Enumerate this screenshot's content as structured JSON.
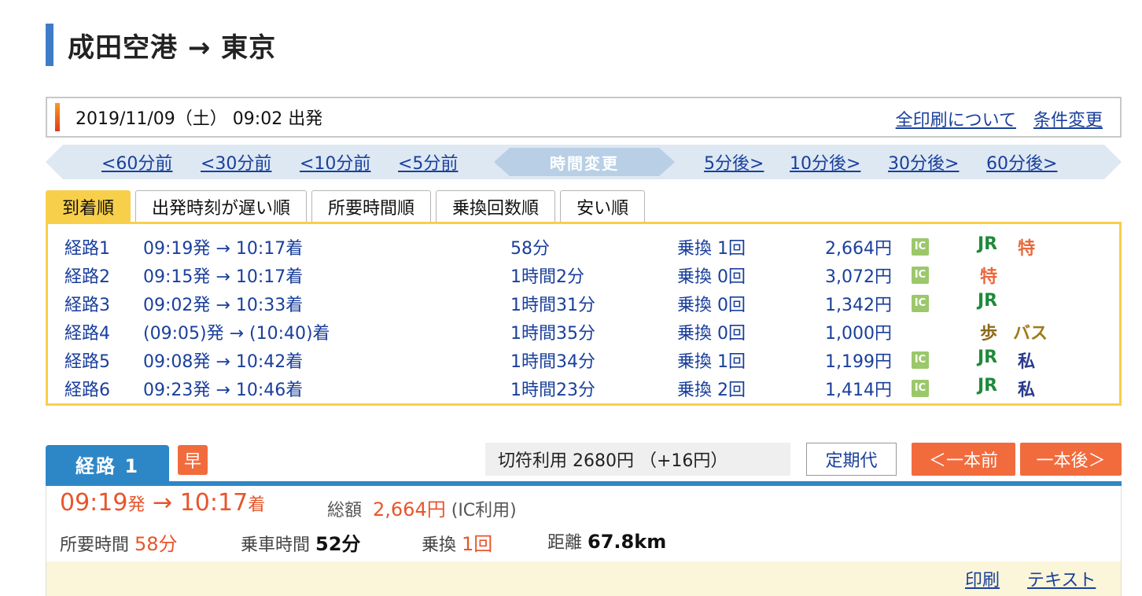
{
  "title": "成田空港 → 東京",
  "search": {
    "datetime": "2019/11/09（土） 09:02 出発",
    "print_all": "全印刷について",
    "change_cond": "条件変更"
  },
  "time_shift": {
    "before": [
      "<60分前",
      "<30分前",
      "<10分前",
      "<5分前"
    ],
    "center": "時間変更",
    "after": [
      "5分後>",
      "10分後>",
      "30分後>",
      "60分後>"
    ]
  },
  "sort_tabs": [
    "到着順",
    "出発時刻が遅い順",
    "所要時間順",
    "乗換回数順",
    "安い順"
  ],
  "routes": [
    {
      "name": "経路1",
      "time": "09:19発 → 10:17着",
      "duration": "58分",
      "transfer": "乗換 1回",
      "fare": "2,664円",
      "ic": true,
      "tags": [
        "JR",
        "特"
      ]
    },
    {
      "name": "経路2",
      "time": "09:15発 → 10:17着",
      "duration": "1時間2分",
      "transfer": "乗換 0回",
      "fare": "3,072円",
      "ic": true,
      "tags": [
        "特"
      ]
    },
    {
      "name": "経路3",
      "time": "09:02発 → 10:33着",
      "duration": "1時間31分",
      "transfer": "乗換 0回",
      "fare": "1,342円",
      "ic": true,
      "tags": [
        "JR"
      ]
    },
    {
      "name": "経路4",
      "time": "(09:05)発 → (10:40)着",
      "duration": "1時間35分",
      "transfer": "乗換 0回",
      "fare": "1,000円",
      "ic": false,
      "tags": [
        "歩",
        "バス"
      ]
    },
    {
      "name": "経路5",
      "time": "09:08発 → 10:42着",
      "duration": "1時間34分",
      "transfer": "乗換 1回",
      "fare": "1,199円",
      "ic": true,
      "tags": [
        "JR",
        "私"
      ]
    },
    {
      "name": "経路6",
      "time": "09:23発 → 10:46着",
      "duration": "1時間23分",
      "transfer": "乗換 2回",
      "fare": "1,414円",
      "ic": true,
      "tags": [
        "JR",
        "私"
      ]
    }
  ],
  "ic_label": "IC",
  "detail": {
    "tab": "経路 1",
    "badge": "早",
    "kippu": "切符利用  2680円 （+16円）",
    "teiki": "定期代",
    "prev": "＜一本前",
    "next": "一本後＞",
    "dep": "09:19",
    "dep_suffix": "発",
    "arrow": "→",
    "arr": "10:17",
    "arr_suffix": "着",
    "total_label": "総額",
    "total": "2,664円",
    "total_note": "(IC利用)",
    "req_label": "所要時間",
    "req": "58分",
    "ride_label": "乗車時間",
    "ride": "52分",
    "xfer_label": "乗換",
    "xfer": "1回",
    "dist_label": "距離",
    "dist": "67.8km",
    "print": "印刷",
    "text": "テキスト"
  },
  "colors": {
    "accent_blue": "#2d87c6",
    "orange": "#f26b3d",
    "yellow": "#f8cf4a",
    "link": "#1a3f9c"
  }
}
